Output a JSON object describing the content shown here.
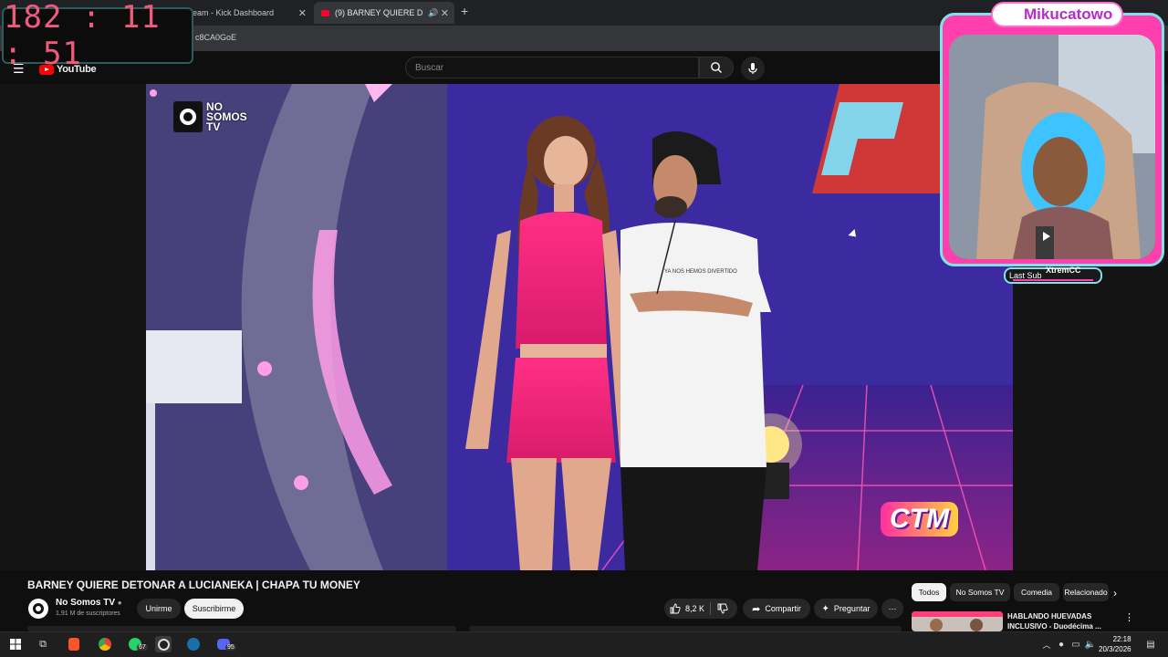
{
  "timer": "182 : 11 : 51",
  "browser": {
    "tabs": [
      {
        "label": "ream - Kick Dashboard"
      },
      {
        "label": "(9) BARNEY QUIERE DETON"
      }
    ],
    "url": "c8CA0GoE"
  },
  "youtube": {
    "logo_text": "YouTube",
    "search_placeholder": "Buscar"
  },
  "video": {
    "watermark_line1": "NO",
    "watermark_line2": "SOMOS",
    "watermark_line3": "TV",
    "show_badge": "CTM",
    "shirt_text": "YA NOS HEMOS DIVERTIDO"
  },
  "overlay": {
    "channel_name": "Mikucatowo",
    "last_sub_label": "Last Sub",
    "last_sub_value": "XtremCC"
  },
  "details": {
    "title": "BARNEY QUIERE DETONAR A LUCIANEKA | CHAPA TU MONEY",
    "channel": "No Somos TV",
    "subscribers": "1,91 M de suscriptores",
    "join_label": "Unirme",
    "subscribe_label": "Suscribirme",
    "likes": "8,2 K",
    "share_label": "Compartir",
    "ask_label": "Preguntar"
  },
  "sidebar": {
    "chips": [
      "Todos",
      "No Somos TV",
      "Comedia",
      "Relacionado"
    ],
    "rec_title": "HABLANDO HUEVADAS INCLUSIVO - Duodécima ..."
  },
  "taskbar": {
    "whatsapp_badge": "67",
    "discord_badge": "95",
    "time": "22:18",
    "date": "20/3/2026"
  },
  "colors": {
    "accent_red": "#ff0000",
    "timer_color": "#f05a7e",
    "overlay_pink": "#ff3fae",
    "overlay_cyan": "#7de3e8"
  }
}
